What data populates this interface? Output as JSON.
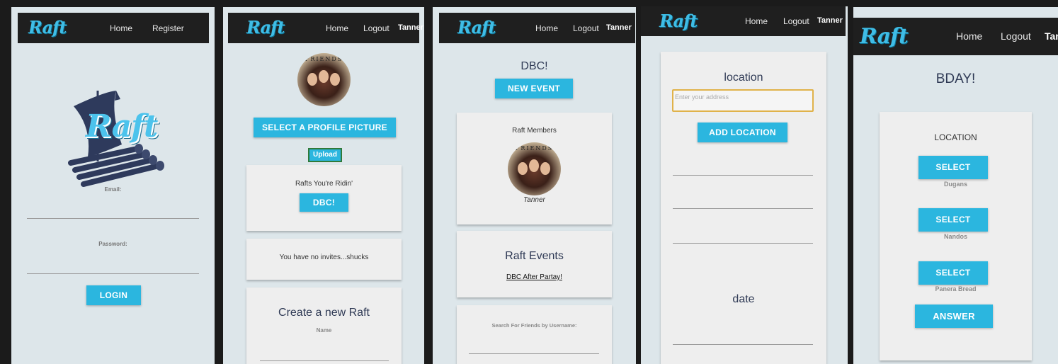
{
  "brand": "Raft",
  "panel1": {
    "nav": [
      "Home",
      "Register"
    ],
    "email_label": "Email:",
    "password_label": "Password:",
    "login_button": "LOGIN"
  },
  "panel2": {
    "nav": [
      "Home",
      "Logout"
    ],
    "user": "Tanner",
    "avatar_word": "FRIENDS",
    "select_picture_button": "SELECT A PROFILE PICTURE",
    "upload_button": "Upload",
    "rafts_heading": "Rafts You're Ridin'",
    "raft_button": "DBC!",
    "invites_text": "You have no invites...shucks",
    "create_heading": "Create a new Raft",
    "name_label": "Name"
  },
  "panel3": {
    "nav": [
      "Home",
      "Logout"
    ],
    "user": "Tanner",
    "title": "DBC!",
    "new_event_button": "NEW EVENT",
    "members_heading": "Raft Members",
    "member_name": "Tanner",
    "avatar_word": "FRIENDS",
    "events_heading": "Raft Events",
    "event_link": "DBC After Partay!",
    "search_label": "Search For Friends by Username:"
  },
  "panel4": {
    "nav": [
      "Home",
      "Logout"
    ],
    "user": "Tanner",
    "location_heading": "location",
    "address_placeholder": "Enter your address",
    "add_location_button": "ADD LOCATION",
    "date_heading": "date"
  },
  "panel5": {
    "nav": [
      "Home",
      "Logout"
    ],
    "user": "Tar",
    "title": "BDAY!",
    "location_heading": "LOCATION",
    "options": [
      {
        "button": "SELECT",
        "name": "Dugans"
      },
      {
        "button": "SELECT",
        "name": "Nandos"
      },
      {
        "button": "SELECT",
        "name": "Panera Bread"
      }
    ],
    "answer_button": "ANSWER"
  }
}
